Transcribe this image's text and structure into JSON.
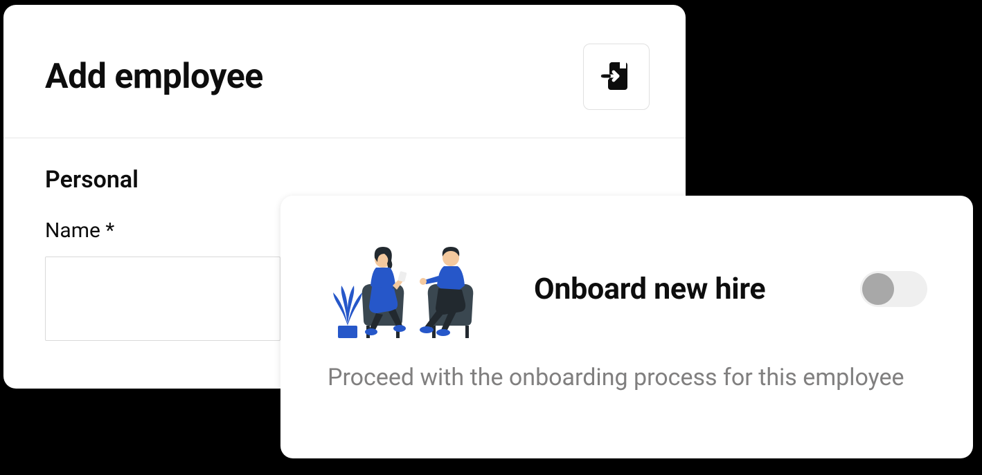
{
  "addEmployee": {
    "title": "Add employee",
    "importIcon": "import-file-icon",
    "sections": {
      "personal": {
        "title": "Personal",
        "fields": {
          "name": {
            "label": "Name *",
            "value": ""
          }
        }
      }
    }
  },
  "onboard": {
    "title": "Onboard new hire",
    "description": "Proceed with the onboarding process for this employee",
    "toggle": {
      "state": "off"
    },
    "illustration": "interview-illustration"
  },
  "colors": {
    "text": "#0d0d0d",
    "muted": "#807f7f",
    "toggleTrack": "#efefef",
    "toggleKnob": "#a8a8a8",
    "illustrationBlue": "#2657c9",
    "illustrationDark": "#22292f"
  }
}
